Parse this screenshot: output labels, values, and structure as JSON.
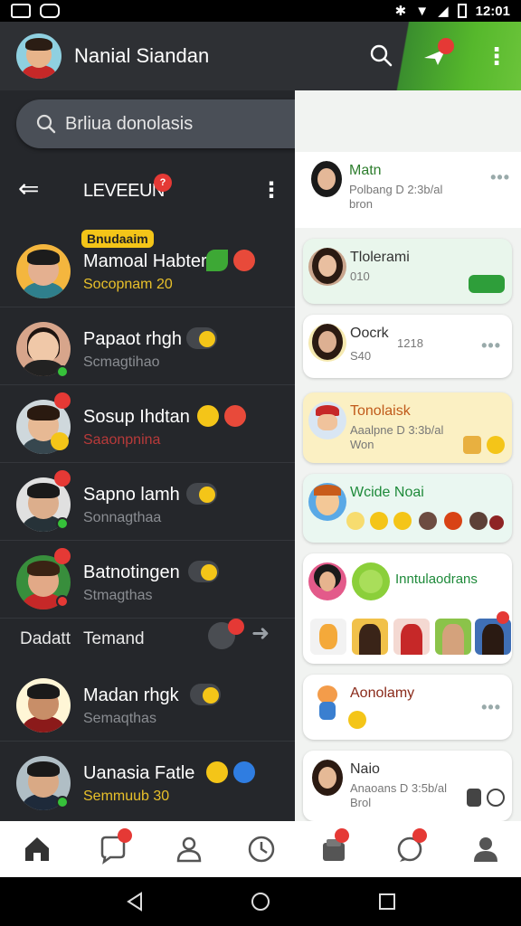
{
  "status_bar": {
    "time": "12:01"
  },
  "header": {
    "title": "Nanial Siandan",
    "send_badge": ""
  },
  "search": {
    "placeholder": "Brliua donolasis"
  },
  "list_header": {
    "back_glyph": "⇐",
    "label": "LEVEEUN",
    "badge": "?",
    "more_glyph": "⋮"
  },
  "chats": [
    {
      "pill": "Bnudaaim",
      "name": "Mamoal Habter",
      "sub": "Socopnam 20",
      "sub_color": "#e8c02a"
    },
    {
      "name": "Papaot rhgh",
      "sub": "Scmagtihao",
      "sub_color": "#8a8d92"
    },
    {
      "name": "Sosup Ihdtan",
      "sub": "Saaonpnina",
      "sub_color": "#b83a3a"
    },
    {
      "name": "Sapno lamh",
      "sub": "Sonnagthaa",
      "sub_color": "#8a8d92"
    },
    {
      "name": "Batnotingen",
      "sub": "Stmagthas",
      "sub_color": "#8a8d92"
    },
    {
      "name": "Madan rhgk",
      "sub": "Semaqthas",
      "sub_color": "#8a8d92"
    },
    {
      "name": "Uanasia Fatle",
      "sub": "Semmuub 30",
      "sub_color": "#e8c02a"
    }
  ],
  "tabs_row": {
    "left": "Dadatt",
    "right": "Temand"
  },
  "cards": [
    {
      "title": "Matn",
      "sub1": "Polbang D 2:3b/al",
      "sub2": "bron",
      "accent": "#2d7d2d"
    },
    {
      "title": "Tlolerami",
      "sub1": "010",
      "sub2": ""
    },
    {
      "title": "Oocrk",
      "sub1": "S40",
      "sub2": "1218"
    },
    {
      "title": "Tonolaisk",
      "sub1": "Aaalpne D 3:3b/al",
      "sub2": "Won",
      "accent": "#c05a1a"
    },
    {
      "title": "Wcide Noai",
      "sub1": "",
      "sub2": ""
    },
    {
      "title": "Inntulaodrans",
      "sub1": "",
      "sub2": ""
    },
    {
      "title": "Aonolamy",
      "sub1": "",
      "sub2": ""
    },
    {
      "title": "Naio",
      "sub1": "Anaoans D 3:5b/al",
      "sub2": "Brol"
    }
  ],
  "colors": {
    "header_bg": "#2e3034",
    "accent_green": "#56b82c",
    "panel_dark": "#25272b",
    "panel_light": "#f1f3f1"
  },
  "icons": [
    "search-icon",
    "send-icon",
    "more-vertical-icon",
    "back-arrow-icon",
    "home-icon",
    "chat-icon",
    "contacts-icon",
    "clock-icon",
    "inbox-icon",
    "message-icon",
    "profile-icon"
  ]
}
